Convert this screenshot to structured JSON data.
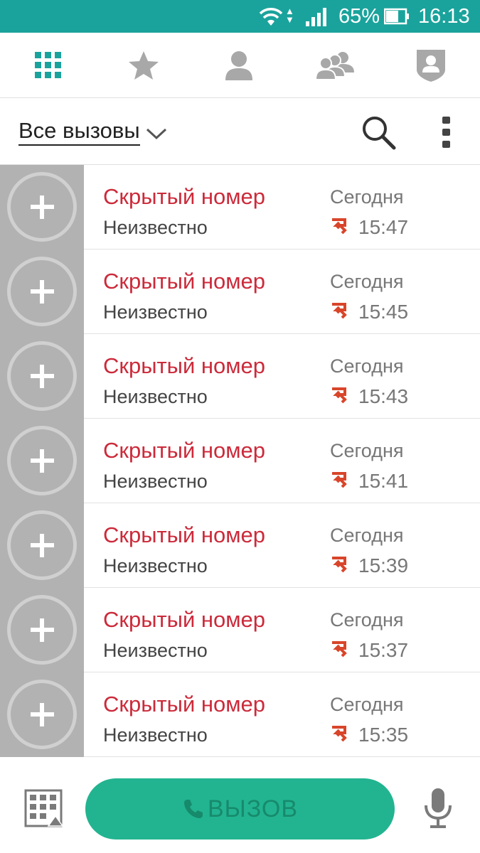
{
  "status_bar": {
    "battery_percent": "65%",
    "time": "16:13",
    "background_color": "#1aa39c"
  },
  "tabs": [
    {
      "name": "dialpad",
      "icon": "grid-icon",
      "active": true
    },
    {
      "name": "favorites",
      "icon": "star-icon",
      "active": false
    },
    {
      "name": "contacts",
      "icon": "person-icon",
      "active": false
    },
    {
      "name": "groups",
      "icon": "people-icon",
      "active": false
    },
    {
      "name": "profile",
      "icon": "shield-person-icon",
      "active": false
    }
  ],
  "filter": {
    "selected": "Все вызовы"
  },
  "calls": [
    {
      "name": "Скрытый номер",
      "label": "Неизвестно",
      "day": "Сегодня",
      "time": "15:47",
      "type": "missed"
    },
    {
      "name": "Скрытый номер",
      "label": "Неизвестно",
      "day": "Сегодня",
      "time": "15:45",
      "type": "missed"
    },
    {
      "name": "Скрытый номер",
      "label": "Неизвестно",
      "day": "Сегодня",
      "time": "15:43",
      "type": "missed"
    },
    {
      "name": "Скрытый номер",
      "label": "Неизвестно",
      "day": "Сегодня",
      "time": "15:41",
      "type": "missed"
    },
    {
      "name": "Скрытый номер",
      "label": "Неизвестно",
      "day": "Сегодня",
      "time": "15:39",
      "type": "missed"
    },
    {
      "name": "Скрытый номер",
      "label": "Неизвестно",
      "day": "Сегодня",
      "time": "15:37",
      "type": "missed"
    },
    {
      "name": "Скрытый номер",
      "label": "Неизвестно",
      "day": "Сегодня",
      "time": "15:35",
      "type": "missed"
    }
  ],
  "bottom_bar": {
    "call_button_label": "ВЫЗОВ"
  },
  "colors": {
    "accent": "#1aa39c",
    "missed_call": "#cc2a3a",
    "call_button": "#22b490"
  }
}
